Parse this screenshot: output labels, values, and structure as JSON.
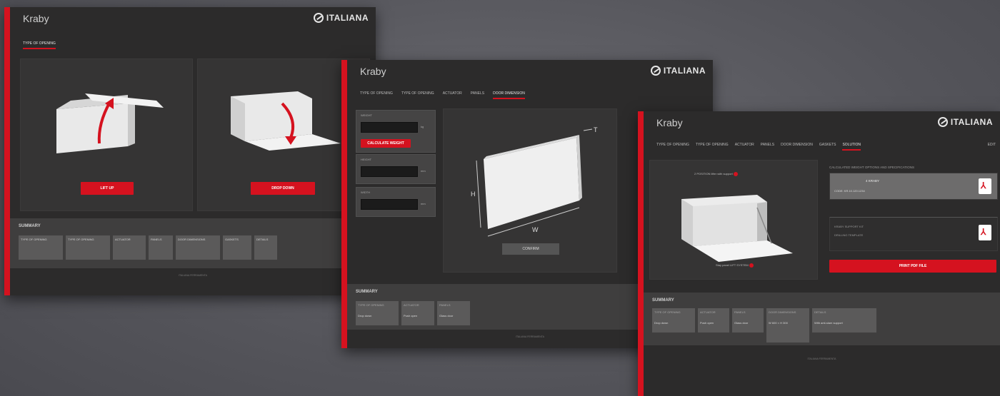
{
  "screen1": {
    "brand": "Kraby",
    "logo": "ITALIANA",
    "tabs": [
      "TYPE OF OPENING"
    ],
    "active_tab": 0,
    "options": [
      {
        "button": "LIFT UP"
      },
      {
        "button": "DROP DOWN"
      }
    ],
    "summary_title": "SUMMARY",
    "chips": [
      "TYPE OF OPENING",
      "TYPE OF OPENING",
      "ACTUATOR",
      "PANELS",
      "DOOR DIMENSIONS",
      "GASKETS",
      "DETAILS"
    ],
    "footer": "ITALIANA FERRAMENTA"
  },
  "screen2": {
    "brand": "Kraby",
    "logo": "ITALIANA",
    "tabs": [
      "TYPE OF OPENING",
      "TYPE OF OPENING",
      "ACTUATOR",
      "PANELS",
      "DOOR DIMENSION"
    ],
    "active_tab": 4,
    "fields": [
      {
        "label": "WEIGHT",
        "unit": "kg",
        "button": "CALCULATE WEIGHT"
      },
      {
        "label": "HEIGHT",
        "unit": "mm"
      },
      {
        "label": "WIDTH",
        "unit": "mm"
      }
    ],
    "dims": {
      "h": "H",
      "w": "W",
      "t": "T"
    },
    "confirm": "CONFIRM",
    "summary_title": "SUMMARY",
    "chips": [
      {
        "label": "TYPE OF OPENING",
        "value": "Drop down"
      },
      {
        "label": "ACTUATOR",
        "value": "Push open"
      },
      {
        "label": "PANELS",
        "value": "Glass door"
      }
    ],
    "footer": "ITALIANA FERRAMENTA"
  },
  "screen3": {
    "brand": "Kraby",
    "logo": "ITALIANA",
    "tabs": [
      "TYPE OF OPENING",
      "TYPE OF OPENING",
      "ACTUATOR",
      "PANELS",
      "DOOR DIMENSION",
      "GASKETS",
      "SOLUTION"
    ],
    "active_tab": 6,
    "edit": "EDIT",
    "callouts": [
      "2 POSITION lifter with support",
      "Stay panel LIFT SYSTEM"
    ],
    "result_title": "CALCULATED WEIGHT OPTIONS AND SPECIFICATIONS",
    "result_lines": [
      "4 KRABY",
      "CODE: KR.10.120.1234"
    ],
    "secondary_lines": [
      "KRABY SUPPORT KIT",
      "DRILLING TEMPLATE"
    ],
    "print_button": "PRINT PDF FILE",
    "summary_title": "SUMMARY",
    "chips": [
      {
        "label": "TYPE OF OPENING",
        "value": "Drop down"
      },
      {
        "label": "ACTUATOR",
        "value": "Push open"
      },
      {
        "label": "PANELS",
        "value": "Glass door"
      },
      {
        "label": "DOOR DIMENSIONS",
        "value": "W 600 × H 300"
      },
      {
        "label": "DETAILS",
        "value": "With anti-slam support"
      }
    ],
    "footer": "ITALIANA FERRAMENTA"
  },
  "colors": {
    "accent": "#d5121f",
    "panel": "#2c2b2b",
    "background": "#58585e"
  }
}
